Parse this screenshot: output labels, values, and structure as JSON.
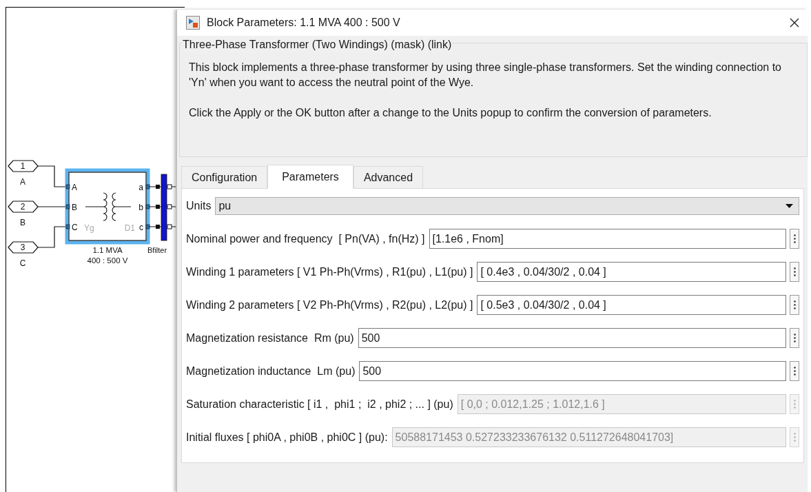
{
  "diagram": {
    "inports": [
      {
        "number": "1",
        "label": "A"
      },
      {
        "number": "2",
        "label": "B"
      },
      {
        "number": "3",
        "label": "C"
      }
    ],
    "transformer": {
      "selected": true,
      "inputs": [
        "A",
        "B",
        "C"
      ],
      "outputs": [
        "a",
        "b",
        "c"
      ],
      "primary": "Yg",
      "secondary": "D1",
      "caption": [
        "1.1 MVA",
        "400 : 500 V"
      ]
    },
    "bus": {
      "label": "Bfilter"
    }
  },
  "dialog": {
    "title": "Block Parameters: 1.1 MVA 400 : 500 V",
    "group_title": "Three-Phase Transformer (Two Windings) (mask) (link)",
    "description": [
      "This block implements a three-phase transformer by using three single-phase transformers. Set the winding connection to 'Yn'  when you want to access the neutral point of the Wye.",
      "Click the Apply or the OK button after a change to the Units popup to confirm the conversion of parameters."
    ],
    "tabs": [
      {
        "label": "Configuration",
        "selected": false
      },
      {
        "label": "Parameters",
        "selected": true
      },
      {
        "label": "Advanced",
        "selected": false
      }
    ],
    "params": [
      {
        "kind": "dropdown",
        "label": "Units",
        "value": "pu"
      },
      {
        "kind": "field",
        "label": "Nominal power and frequency  [ Pn(VA) , fn(Hz) ]",
        "value": "[1.1e6 , Fnom]",
        "disabled": false
      },
      {
        "kind": "field",
        "label": "Winding 1 parameters [ V1 Ph-Ph(Vrms) , R1(pu) , L1(pu) ]",
        "value": "[ 0.4e3 , 0.04/30/2 , 0.04 ]",
        "disabled": false
      },
      {
        "kind": "field",
        "label": "Winding 2 parameters [ V2 Ph-Ph(Vrms) , R2(pu) , L2(pu) ]",
        "value": "[ 0.5e3 , 0.04/30/2 , 0.04 ]",
        "disabled": false
      },
      {
        "kind": "field",
        "label": "Magnetization resistance  Rm (pu)",
        "value": "500",
        "disabled": false
      },
      {
        "kind": "field",
        "label": "Magnetization inductance  Lm (pu)",
        "value": "500",
        "disabled": false
      },
      {
        "kind": "field",
        "label": "Saturation characteristic [ i1 ,  phi1 ;  i2 , phi2 ; ... ] (pu)",
        "value": "[ 0,0 ; 0.012,1.25 ; 1.012,1.6 ]",
        "disabled": true
      },
      {
        "kind": "field",
        "label": "Initial fluxes [ phi0A , phi0B , phi0C ] (pu):",
        "value": "50588171453 0.527233233676132 0.511272648041703]",
        "disabled": true
      }
    ]
  }
}
